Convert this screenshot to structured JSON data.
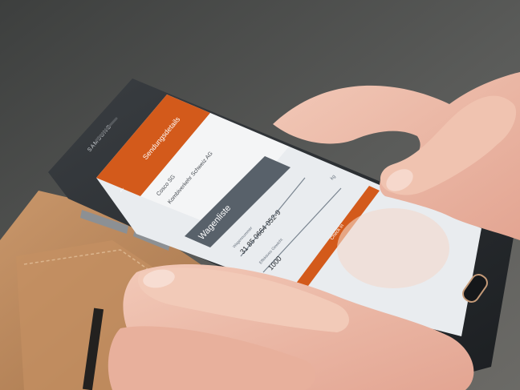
{
  "phone": {
    "brand": "SAMSUNG",
    "app_bar_title": "Sendungsdetails",
    "sender_label": "Cosco SG",
    "receiver_label": "Kombiverkehr Schweiz AG",
    "section_title": "Wagenliste",
    "wagon_number_label": "Wagennummer",
    "wagon_number_value": "31 85 0664 052-9",
    "weight_label": "Effektives Gewicht",
    "weight_value": "1000",
    "weight_unit": "kg",
    "check_button_label": "Check in",
    "colors": {
      "accent": "#d35a1b",
      "screen_bg": "#e9ecef",
      "phone_body": "#2b2f33",
      "wallet": "#b78659"
    }
  }
}
